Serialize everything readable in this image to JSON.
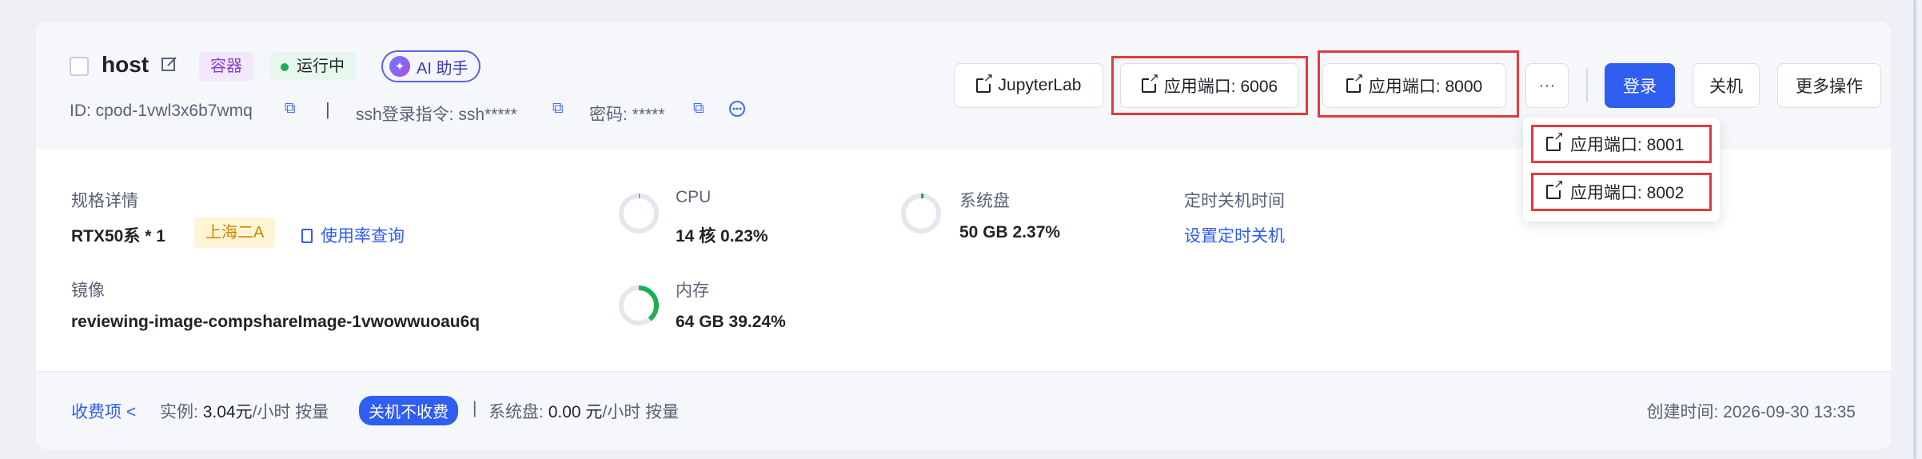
{
  "instance": {
    "name": "host",
    "type_tag": "容器",
    "status": "运行中",
    "ai_assistant": "AI 助手",
    "id_text": "ID: cpod-1vwl3x6b7wmq",
    "divider": "|",
    "ssh_text": "ssh登录指令: ssh*****",
    "password_text": "密码: *****"
  },
  "actions": {
    "jupyter": "JupyterLab",
    "port_6006": "应用端口: 6006",
    "port_8000": "应用端口: 8000",
    "more_dots": "···",
    "login": "登录",
    "shutdown": "关机",
    "more_ops": "更多操作"
  },
  "dropdown": {
    "items": [
      "应用端口: 8001",
      "应用端口: 8002"
    ]
  },
  "specs": {
    "spec_label": "规格详情",
    "gpu": "RTX50系 * 1",
    "region": "上海二A",
    "usage_link": "使用率查询",
    "image_label": "镜像",
    "image_value": "reviewing-image-compshareImage-1vwowwuoau6q",
    "cpu_label": "CPU",
    "cpu_value": "14 核 0.23%",
    "cpu_percent": 0.23,
    "mem_label": "内存",
    "mem_value": "64 GB 39.24%",
    "mem_percent": 39.24,
    "disk_label": "系统盘",
    "disk_value": "50 GB 2.37%",
    "disk_percent": 2.37,
    "shutdown_label": "定时关机时间",
    "shutdown_link": "设置定时关机"
  },
  "billing": {
    "label": "收费项 <",
    "instance_label": "实例:",
    "instance_price": "3.04元",
    "instance_unit": "/小时 按量",
    "badge": "关机不收费",
    "divider": "|",
    "disk_label": "系统盘:",
    "disk_price": "0.00 元",
    "disk_unit": "/小时 按量",
    "created": "创建时间: 2026-09-30 13:35"
  },
  "colors": {
    "primary": "#2f5ef0",
    "success": "#1fae55",
    "highlight": "#e23b3b"
  }
}
